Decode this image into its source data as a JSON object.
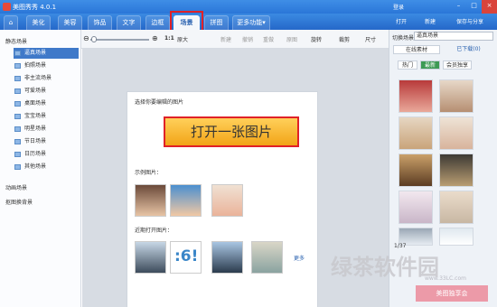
{
  "window": {
    "title": "美图秀秀 4.0.1",
    "min": "–",
    "max": "□",
    "close": "×"
  },
  "tabs": [
    {
      "label": "⌂"
    },
    {
      "label": "美化"
    },
    {
      "label": "美容"
    },
    {
      "label": "饰品"
    },
    {
      "label": "文字"
    },
    {
      "label": "边框"
    },
    {
      "label": "场景"
    },
    {
      "label": "拼图"
    },
    {
      "label": "更多功能▾"
    }
  ],
  "header_actions": {
    "user": "登录",
    "open": "打开",
    "new": "新建",
    "save": "保存与分享"
  },
  "toolbar": {
    "zoom_value": "1:1",
    "zoom_max": "原大",
    "new": "新建",
    "undo": "撤销",
    "redo": "重做",
    "reset": "原图",
    "rotate": "旋转",
    "crop": "裁剪",
    "size": "尺寸"
  },
  "sidebar": {
    "static_heading": "静态场景",
    "items": [
      {
        "label": "逼真场景"
      },
      {
        "label": "拍照场景"
      },
      {
        "label": "非主流场景"
      },
      {
        "label": "可爱场景"
      },
      {
        "label": "桌面场景"
      },
      {
        "label": "宝宝场景"
      },
      {
        "label": "明星场景"
      },
      {
        "label": "节日场景"
      },
      {
        "label": "日历场景"
      },
      {
        "label": "其他场景"
      }
    ],
    "dynamic_heading": "动画场景",
    "cutout_heading": "抠图换背景"
  },
  "main": {
    "heading": "选择你要编辑的图片",
    "open_button": "打开一张图片",
    "examples_label": "示例图片：",
    "recent_label": "近期打开图片：",
    "more": "更多"
  },
  "right_panel": {
    "switch_label": "切换场景",
    "select_value": "逼真场景",
    "tab_online": "在线素材",
    "tab_downloaded": "已下载(0)",
    "subtabs": [
      "热门",
      "最新",
      "会员独享"
    ],
    "pager": "1/37"
  },
  "banner": "美图独享会",
  "watermark": "绿茶软件园",
  "watermark_url": "www.33LC.com",
  "colors": {
    "brand": "#2a76d8",
    "highlight": "#e02128",
    "button": "#f2a417"
  }
}
